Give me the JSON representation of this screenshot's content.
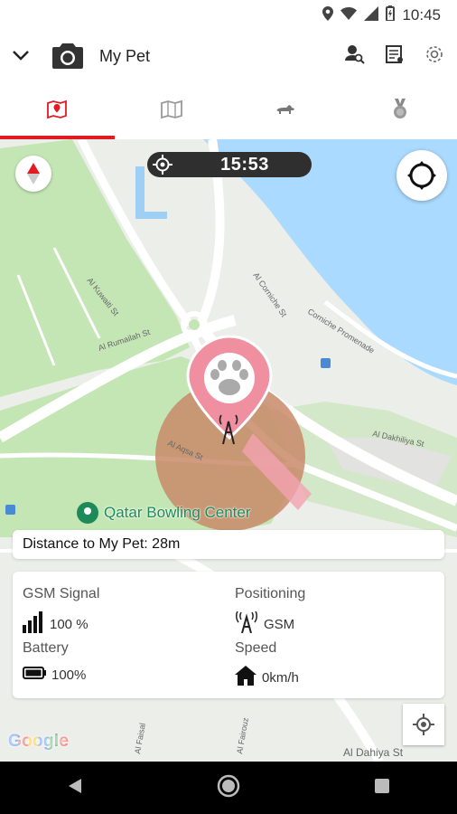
{
  "status_bar": {
    "time": "10:45"
  },
  "app_bar": {
    "title": "My Pet",
    "icons": [
      "chevron-down-icon",
      "camera-icon",
      "person-search-icon",
      "receipt-icon",
      "gear-icon"
    ]
  },
  "tabs": [
    {
      "name": "map-tab",
      "icon": "map-pin-icon",
      "active": true
    },
    {
      "name": "history-map-tab",
      "icon": "folded-map-icon",
      "active": false
    },
    {
      "name": "pet-tab",
      "icon": "dog-icon",
      "active": false
    },
    {
      "name": "award-tab",
      "icon": "medal-icon",
      "active": false
    }
  ],
  "map": {
    "timer": "15:53",
    "place_label": "Qatar Bowling Center",
    "streets": [
      "Al Kuwaiti St",
      "Al Rumailah St",
      "Al Aqsa St",
      "Al Dakhiliya St",
      "Corniche Promenade",
      "Al Corniche St",
      "Al Faisal",
      "Al Fairouz",
      "Al Dahiya St"
    ],
    "accent_color": "#e21b23",
    "water_color": "#aadaff",
    "park_color": "#c4e6b5"
  },
  "distance": {
    "text": "Distance to My Pet: 28m"
  },
  "info": {
    "gsm_label": "GSM Signal",
    "gsm_value": "100 %",
    "positioning_label": "Positioning",
    "positioning_value": "GSM",
    "battery_label": "Battery",
    "battery_value": "100%",
    "speed_label": "Speed",
    "speed_value": "0km/h"
  },
  "google_logo": "Google"
}
